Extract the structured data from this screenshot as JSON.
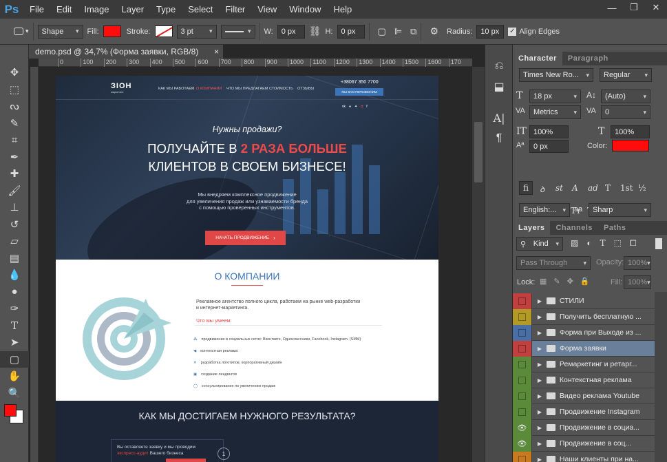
{
  "app": {
    "logo": "Ps"
  },
  "menu": [
    "File",
    "Edit",
    "Image",
    "Layer",
    "Type",
    "Select",
    "Filter",
    "View",
    "Window",
    "Help"
  ],
  "window_buttons": [
    "—",
    "❐",
    "✕"
  ],
  "options": {
    "mode": "Shape",
    "fill_label": "Fill:",
    "fill_color": "#ff0d0d",
    "stroke_label": "Stroke:",
    "stroke_width": "3 pt",
    "w_label": "W:",
    "w_value": "0 px",
    "h_label": "H:",
    "h_value": "0 px",
    "radius_label": "Radius:",
    "radius_value": "10 px",
    "align_edges": "Align Edges"
  },
  "document_tab": {
    "title": "demo.psd @ 34,7% (Форма заявки, RGB/8)",
    "close": "×"
  },
  "ruler": [
    "0",
    "100",
    "200",
    "300",
    "400",
    "500",
    "600",
    "700",
    "800",
    "900",
    "1000",
    "1100",
    "1200",
    "1300",
    "1400",
    "1500",
    "1600",
    "170"
  ],
  "site": {
    "logo": "ЗІОН",
    "logo_sub": "маркетинг",
    "nav": [
      "КАК МЫ РАБОТАЕМ",
      "О КОМПАНИИ",
      "ЧТО МЫ ПРЕДЛАГАЕМ",
      "СТОИМОСТЬ",
      "ОТЗЫВЫ"
    ],
    "phone": "+38067 350 7700",
    "callback": "МЫ ВАМ ПЕРЕЗВОНИМ",
    "social": [
      "vk",
      "ok",
      "tw",
      "ig",
      "f"
    ],
    "hero_italic": "Нужны продажи?",
    "hero_line1_a": "ПОЛУЧАЙТЕ В ",
    "hero_line1_b": "2 РАЗА БОЛЬШЕ",
    "hero_line2": "КЛИЕНТОВ В СВОЕМ БИЗНЕСЕ!",
    "hero_sub1": "Мы внедряем комплексное продвижение",
    "hero_sub2": "для увеличения продаж или узнаваемости бренда",
    "hero_sub3": "с помощью проверенных инструментов.",
    "cta": "НАЧАТЬ ПРОДВИЖЕНИЕ",
    "about_title": "О КОМПАНИИ",
    "about_text1": "Рекламное агентство полного цикла, работаем на рынке web-разработки",
    "about_text2": "и интернет-маркетинга.",
    "skills_title": "Что мы умеем:",
    "skills": [
      "продвижение в социальных сетях: Вконтакте, Одноклассники, Facebook, Instagram. (SMM)",
      "контекстная реклама",
      "разработка логотипов, корпоративный дизайн",
      "создание лендингов",
      "консультирование по увеличению продаж"
    ],
    "results_title": "КАК МЫ ДОСТИГАЕМ НУЖНОГО РЕЗУЛЬТАТА?",
    "step1a": "Вы оставляете заявку и мы проводим",
    "step1b": "экспресс-аудит",
    "step1c": " Вашего бизнеса",
    "step_no": "1"
  },
  "character": {
    "tab1": "Character",
    "tab2": "Paragraph",
    "font": "Times New Ro...",
    "style": "Regular",
    "size": "18 px",
    "leading": "(Auto)",
    "kerning": "Metrics",
    "tracking": "0",
    "vscale": "100%",
    "hscale": "100%",
    "baseline": "0 px",
    "color_label": "Color:",
    "color": "#ff0d0d",
    "lang": "English:...",
    "aa_icon": "aa",
    "aa": "Sharp",
    "tbuttons": [
      "T",
      "T",
      "TT",
      "Tт",
      "T¹",
      "T,",
      "T",
      "Ŧ"
    ],
    "obuttons": [
      "fi",
      "ꝺ",
      "st",
      "A",
      "ad",
      "T",
      "1st",
      "½"
    ]
  },
  "layers": {
    "tab1": "Layers",
    "tab2": "Channels",
    "tab3": "Paths",
    "kind": "Kind",
    "blend": "Pass Through",
    "opacity_label": "Opacity:",
    "opacity": "100%",
    "lock_label": "Lock:",
    "fill_label": "Fill:",
    "fill": "100%",
    "items": [
      {
        "name": "СТИЛИ",
        "color": "#c04040",
        "eye": false
      },
      {
        "name": "Получить бесплатную ...",
        "color": "#b39a26",
        "eye": false
      },
      {
        "name": "Форма при Выходе из ...",
        "color": "#4a6fa5",
        "eye": false
      },
      {
        "name": "Форма заявки",
        "color": "#c04040",
        "eye": false
      },
      {
        "name": "Ремаркетинг и ретарг...",
        "color": "#5a8a3a",
        "eye": false
      },
      {
        "name": "Контекстная реклама",
        "color": "#5a8a3a",
        "eye": false
      },
      {
        "name": "Видео реклама Youtube",
        "color": "#5a8a3a",
        "eye": false
      },
      {
        "name": "Продвижение Instagram",
        "color": "#5a8a3a",
        "eye": false
      },
      {
        "name": "Продвижение в социа...",
        "color": "#5a8a3a",
        "eye": true
      },
      {
        "name": " Продвижение в соц...",
        "color": "#5a8a3a",
        "eye": true
      },
      {
        "name": "Наши клиенты при на...",
        "color": "#c77a20",
        "eye": false
      }
    ],
    "selected": 3
  }
}
